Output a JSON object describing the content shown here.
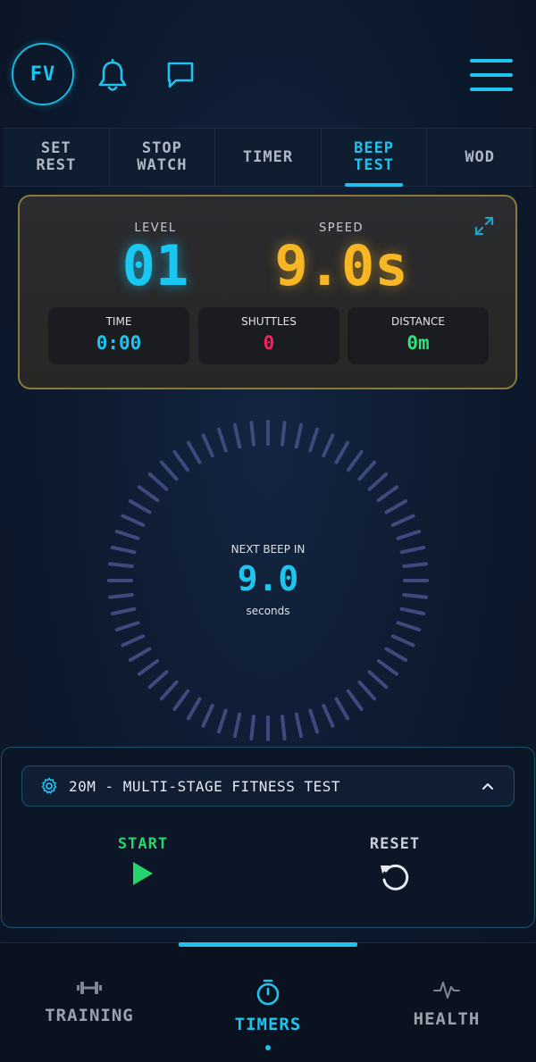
{
  "header": {
    "avatar_initials": "FV",
    "icons": [
      "bell-icon",
      "chat-icon",
      "menu-icon"
    ]
  },
  "tabs": [
    {
      "label": "SET\nREST",
      "active": false
    },
    {
      "label": "STOP\nWATCH",
      "active": false
    },
    {
      "label": "TIMER",
      "active": false
    },
    {
      "label": "BEEP\nTEST",
      "active": true
    },
    {
      "label": "WOD",
      "active": false
    }
  ],
  "stats": {
    "level_label": "LEVEL",
    "level_value": "01",
    "speed_label": "SPEED",
    "speed_value": "9.0s",
    "time_label": "TIME",
    "time_value": "0:00",
    "shuttles_label": "SHUTTLES",
    "shuttles_value": "0",
    "distance_label": "DISTANCE",
    "distance_value": "0m"
  },
  "countdown": {
    "label": "NEXT BEEP IN",
    "value": "9.0",
    "unit": "seconds"
  },
  "control": {
    "test_select": "20M - MULTI-STAGE FITNESS TEST",
    "start_label": "START",
    "reset_label": "RESET"
  },
  "nav": {
    "items": [
      {
        "label": "TRAINING",
        "active": false
      },
      {
        "label": "TIMERS",
        "active": true
      },
      {
        "label": "HEALTH",
        "active": false
      }
    ]
  },
  "colors": {
    "accent": "#1ec3ee",
    "level": "#19c8f2",
    "speed": "#f7b624",
    "shuttles": "#f0245e",
    "distance": "#2ee37a",
    "start": "#27d36b"
  }
}
